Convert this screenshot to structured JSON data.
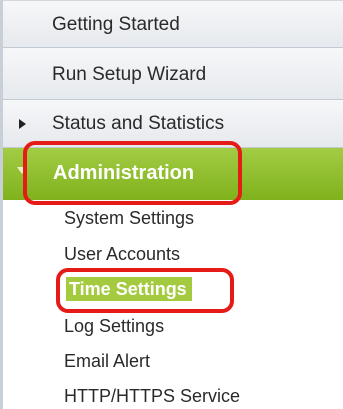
{
  "menu": {
    "items": [
      {
        "label": "Getting Started"
      },
      {
        "label": "Run Setup Wizard"
      },
      {
        "label": "Status and Statistics",
        "icon": "triangle-right-icon"
      },
      {
        "label": "Administration",
        "expanded": true,
        "icon": "triangle-down-icon"
      }
    ],
    "admin_submenu": [
      {
        "label": "System Settings"
      },
      {
        "label": "User Accounts"
      },
      {
        "label": "Time Settings",
        "selected": true
      },
      {
        "label": "Log Settings"
      },
      {
        "label": "Email Alert"
      },
      {
        "label": "HTTP/HTTPS Service"
      }
    ]
  },
  "colors": {
    "accent_green": "#8cbf2a",
    "highlight_red": "#e41b17",
    "menu_bg": "#eceef1"
  }
}
